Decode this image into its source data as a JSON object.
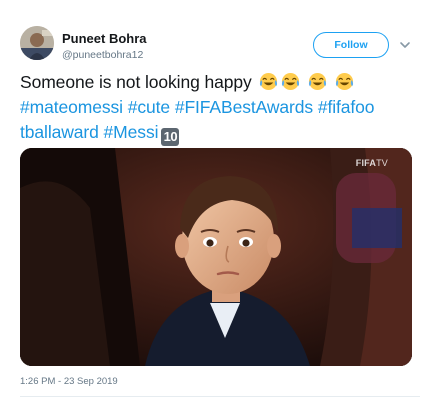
{
  "user": {
    "display_name": "Puneet Bohra",
    "handle": "@puneetbohra12"
  },
  "follow_button": {
    "label": "Follow"
  },
  "more_menu": {
    "icon": "chevron-down-icon"
  },
  "tweet": {
    "line1": {
      "text": "Someone is not looking happy",
      "emojis": [
        "face-with-tears-of-joy-icon",
        "face-with-tears-of-joy-icon",
        "face-with-tears-of-joy-icon",
        "face-with-tears-of-joy-icon"
      ]
    },
    "line2": [
      "#mateomessi",
      "#cute",
      "#FIFABestAwards",
      "#fifafoo"
    ],
    "line3": {
      "hashtags": [
        "tballaward",
        "#Messi"
      ],
      "emoji_ten": "10"
    }
  },
  "media": {
    "description_icon": "video-still",
    "watermark_brand": "FIFA",
    "watermark_suffix": "TV"
  },
  "meta": {
    "timestamp": "1:26 PM - 23 Sep 2019"
  },
  "colors": {
    "link": "#1b95e0",
    "follow": "#1da1f2",
    "text": "#14171a",
    "muted": "#657786"
  }
}
